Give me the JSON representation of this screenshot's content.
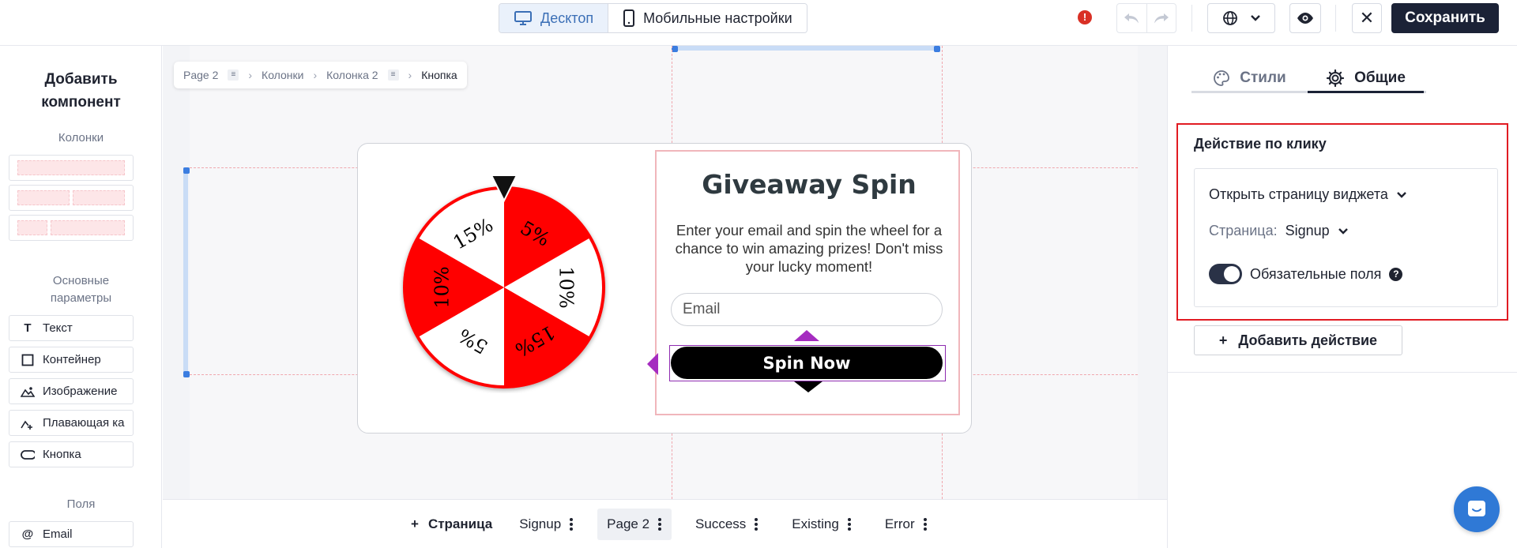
{
  "topbar": {
    "desktop_label": "Десктоп",
    "mobile_label": "Мобильные настройки",
    "alert_glyph": "!",
    "save_label": "Сохранить",
    "close_glyph": "✕",
    "accent_color": "#1b2236"
  },
  "sidebar": {
    "title": "Добавить компонент",
    "columns_section": "Колонки",
    "basic_section": "Основные параметры",
    "fields_section": "Поля",
    "components": [
      {
        "label": "Текст",
        "icon": "text-icon"
      },
      {
        "label": "Контейнер",
        "icon": "container-icon"
      },
      {
        "label": "Изображение",
        "icon": "image-icon"
      },
      {
        "label": "Плавающая ка",
        "icon": "floating-icon"
      },
      {
        "label": "Кнопка",
        "icon": "button-icon"
      }
    ],
    "fields": [
      {
        "label": "Email",
        "icon": "at-icon"
      }
    ]
  },
  "breadcrumb": {
    "items": [
      "Page 2",
      "Колонки",
      "Колонка 2",
      "Кнопка"
    ]
  },
  "widget": {
    "title": "Giveaway Spin",
    "text": "Enter your email and spin the wheel for a chance to win amazing prizes! Don't miss your lucky moment!",
    "email_placeholder": "Email",
    "button_label": "Spin Now",
    "wheel_segments": [
      "5%",
      "10%",
      "15%",
      "5%",
      "10%",
      "15%"
    ],
    "wheel_colors": [
      "#ff0000",
      "#ffffff"
    ]
  },
  "pages": {
    "add_label": "Страница",
    "tabs": [
      "Signup",
      "Page 2",
      "Success",
      "Existing",
      "Error"
    ],
    "active": "Page 2"
  },
  "rpanel": {
    "tab_styles": "Стили",
    "tab_general": "Общие",
    "action_title": "Действие по клику",
    "action_type": "Открыть страницу виджета",
    "page_label": "Страница:",
    "page_value": "Signup",
    "required_label": "Обязательные поля",
    "required_on": true,
    "add_action_label": "Добавить действие"
  }
}
